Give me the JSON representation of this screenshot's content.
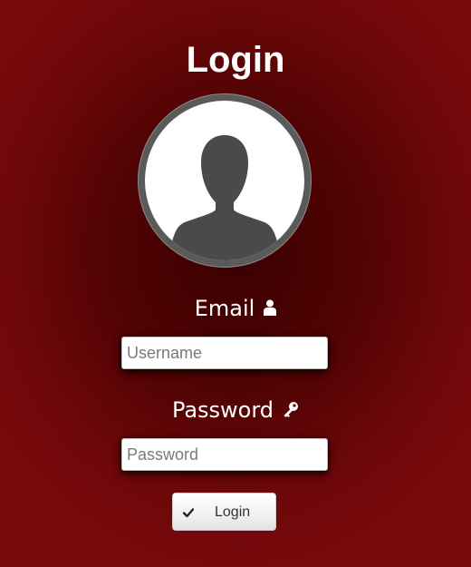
{
  "page": {
    "title": "Login"
  },
  "avatar": {
    "icon": "user-silhouette-icon"
  },
  "email": {
    "label": "Email",
    "icon": "user-icon",
    "placeholder": "Username",
    "value": ""
  },
  "password": {
    "label": "Password",
    "icon": "key-icon",
    "placeholder": "Password",
    "value": ""
  },
  "login_button": {
    "label": "Login",
    "icon": "checkmark-icon"
  },
  "colors": {
    "background_center": "#3a0000",
    "background_edge": "#7a090b",
    "text": "#ffffff",
    "avatar_silhouette": "#4a4a4a"
  }
}
